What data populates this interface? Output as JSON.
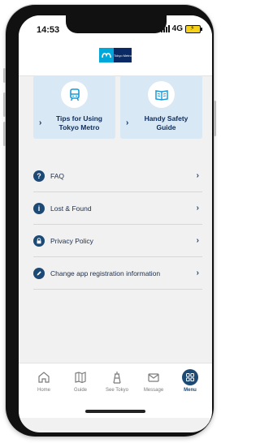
{
  "status_bar": {
    "time": "14:53",
    "network": "4G"
  },
  "header": {
    "logo_text": "Tokyo Metro"
  },
  "tiles": [
    {
      "label": "Tips for Using Tokyo Metro",
      "icon": "train-icon"
    },
    {
      "label": "Handy Safety Guide",
      "icon": "book-icon"
    }
  ],
  "menu": [
    {
      "label": "FAQ",
      "icon": "question-icon"
    },
    {
      "label": "Lost & Found",
      "icon": "info-icon"
    },
    {
      "label": "Privacy Policy",
      "icon": "lock-icon"
    },
    {
      "label": "Change app registration information",
      "icon": "pencil-icon"
    }
  ],
  "tabs": [
    {
      "label": "Home",
      "icon": "home-icon"
    },
    {
      "label": "Guide",
      "icon": "map-icon"
    },
    {
      "label": "See Tokyo",
      "icon": "tower-icon"
    },
    {
      "label": "Message",
      "icon": "mail-icon"
    },
    {
      "label": "Menu",
      "icon": "grid-icon",
      "active": true
    }
  ],
  "colors": {
    "navy": "#1d4a75",
    "tile_bg": "#d9e8f5",
    "battery": "#f6d11a",
    "logo_blue": "#00a7db"
  }
}
